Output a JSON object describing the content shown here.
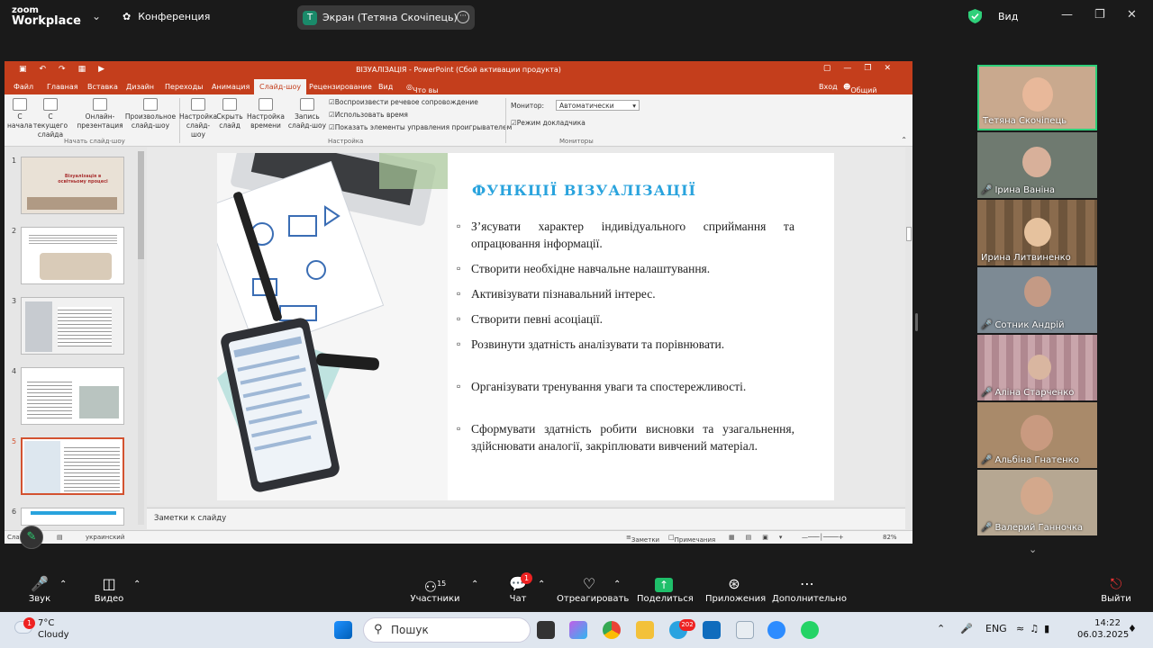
{
  "zoom": {
    "logo_line1": "zoom",
    "logo_line2": "Workplace",
    "meeting_label": "Конференция",
    "share_pill_label": "Экран (Тетяна Скочіпець)",
    "share_pill_initial": "T",
    "view_label": "Вид",
    "accent_green": "#2fd07a"
  },
  "ppt": {
    "window_title": "ВІЗУАЛІЗАЦІЯ - PowerPoint (Сбой активации продукта)",
    "tabs": [
      "Файл",
      "Главная",
      "Вставка",
      "Дизайн",
      "Переходы",
      "Анимация",
      "Слайд-шоу",
      "Рецензирование",
      "Вид"
    ],
    "active_tab": "Слайд-шоу",
    "tell_me": "Что вы хотите сделать?",
    "signin": "Вход",
    "share": "Общий доступ",
    "ribbon": {
      "from_start": "С начала",
      "from_current": "С текущего слайда",
      "online": "Онлайн-презентация",
      "custom": "Произвольное слайд-шоу",
      "group_start": "Начать слайд-шоу",
      "setup": "Настройка слайд-шоу",
      "hide": "Скрыть слайд",
      "rehearse": "Настройка времени",
      "record": "Запись слайд-шоу",
      "chk_narration": "Воспроизвести речевое сопровождение",
      "chk_timings": "Использовать время",
      "chk_controls": "Показать элементы управления проигрывателем",
      "group_setup": "Настройка",
      "monitor_label": "Монитор:",
      "monitor_value": "Автоматически",
      "presenter_view": "Режим докладчика",
      "group_monitors": "Мониторы"
    },
    "thumbs": [
      {
        "num": "1",
        "caption": "Візуалізація в освітньому процесі"
      },
      {
        "num": "2",
        "caption": ""
      },
      {
        "num": "3",
        "caption": ""
      },
      {
        "num": "4",
        "caption": ""
      },
      {
        "num": "5",
        "caption": ""
      },
      {
        "num": "6",
        "caption": ""
      }
    ],
    "slide": {
      "title": "ФУНКЦІЇ ВІЗУАЛІЗАЦІЇ",
      "bullets": [
        "З’ясувати характер індивідуального сприймання та опрацювання інформації.",
        "Створити необхідне навчальне налаштування.",
        "Активізувати пізнавальний інтерес.",
        "Створити певні асоціації.",
        "Розвинути здатність аналізувати та порівнювати.",
        "Організувати тренування уваги та спостережливості.",
        "Сформувати здатність робити висновки та узагальнення, здійснювати аналогії, закріплювати вивчений матеріал."
      ]
    },
    "notes_placeholder": "Заметки к слайду",
    "status": {
      "slide": "Сла",
      "language": "украинский",
      "notes": "Заметки",
      "comments": "Примечания",
      "zoom": "82%"
    }
  },
  "participants": [
    {
      "name": "Тетяна Скочіпець",
      "muted": false,
      "speaking": true,
      "bg": "#c9a98e"
    },
    {
      "name": "Ірина Ваніна",
      "muted": true,
      "speaking": false,
      "bg": "#6f7a70"
    },
    {
      "name": "Ирина Литвиненко",
      "muted": false,
      "speaking": false,
      "bg": "#8a6b4d"
    },
    {
      "name": "Сотник Андрій",
      "muted": true,
      "speaking": false,
      "bg": "#7d8a94"
    },
    {
      "name": "Аліна Старченко",
      "muted": true,
      "speaking": false,
      "bg": "#b08890"
    },
    {
      "name": "Альбіна Гнатенко",
      "muted": true,
      "speaking": false,
      "bg": "#a98a6a"
    },
    {
      "name": "Валерий Ганночка",
      "muted": true,
      "speaking": false,
      "bg": "#b6a792"
    }
  ],
  "controls": {
    "audio": "Звук",
    "video": "Видео",
    "participants": "Участники",
    "participants_count": "15",
    "chat": "Чат",
    "chat_badge": "1",
    "react": "Отреагировать",
    "share": "Поделиться",
    "apps": "Приложения",
    "more": "Дополнительно",
    "leave": "Выйти"
  },
  "taskbar": {
    "weather_badge": "1",
    "temp": "7°C",
    "condition": "Cloudy",
    "search": "Пошук",
    "telegram_badge": "202",
    "lang": "ENG",
    "time": "14:22",
    "date": "06.03.2025"
  }
}
